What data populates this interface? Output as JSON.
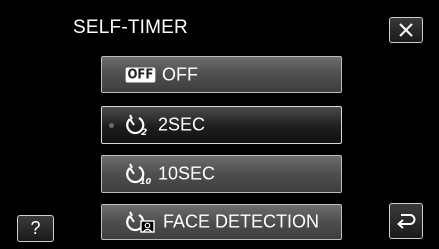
{
  "header": {
    "title": "SELF-TIMER"
  },
  "options": [
    {
      "icon_text": "OFF",
      "label": "OFF",
      "icon": "off-icon",
      "selected": false
    },
    {
      "label": "2SEC",
      "icon": "self-timer-2sec-icon",
      "icon_sub": "2",
      "selected": true
    },
    {
      "label": "10SEC",
      "icon": "self-timer-10sec-icon",
      "icon_sub": "10",
      "selected": false
    },
    {
      "label": "FACE DETECTION",
      "icon": "self-timer-face-detection-icon",
      "selected": false
    }
  ],
  "buttons": {
    "help_label": "?",
    "close_icon": "close-icon",
    "back_icon": "back-icon"
  },
  "colors": {
    "background": "#000000",
    "option_fill": "#5a5a5a",
    "selected_fill": "#1e1e1e",
    "border": "#bdbdbd",
    "text": "#ffffff"
  }
}
